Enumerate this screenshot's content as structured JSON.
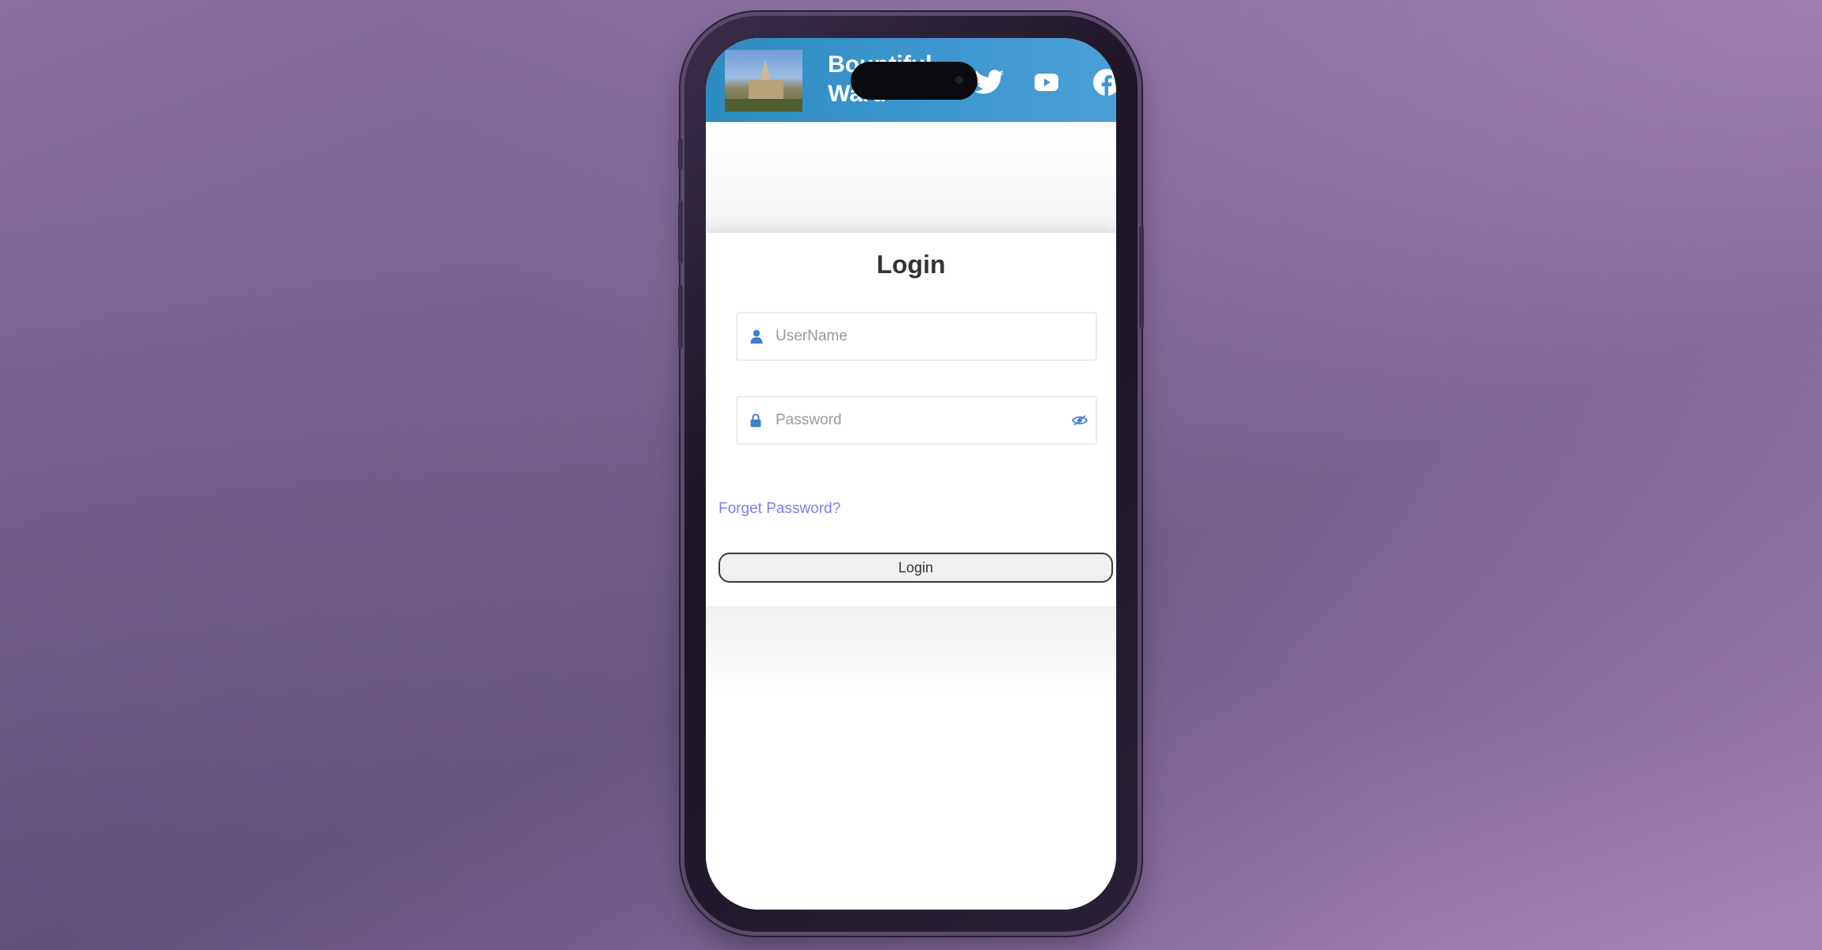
{
  "header": {
    "title": "Bountiful Ward",
    "social": [
      {
        "icon": "twitter-icon"
      },
      {
        "icon": "youtube-icon"
      },
      {
        "icon": "facebook-icon"
      }
    ]
  },
  "login_card": {
    "title": "Login",
    "username": {
      "value": "",
      "placeholder": "UserName",
      "icon": "user-icon"
    },
    "password": {
      "value": "",
      "placeholder": "Password",
      "icon": "lock-icon",
      "toggle_icon": "eye-icon"
    },
    "forgot_link": "Forget Password?",
    "submit_label": "Login"
  },
  "colors": {
    "header_start": "#2d8bbf",
    "header_end": "#4a9fd6",
    "link": "#7a7ef0",
    "icon_accent": "#3e7fd0"
  }
}
